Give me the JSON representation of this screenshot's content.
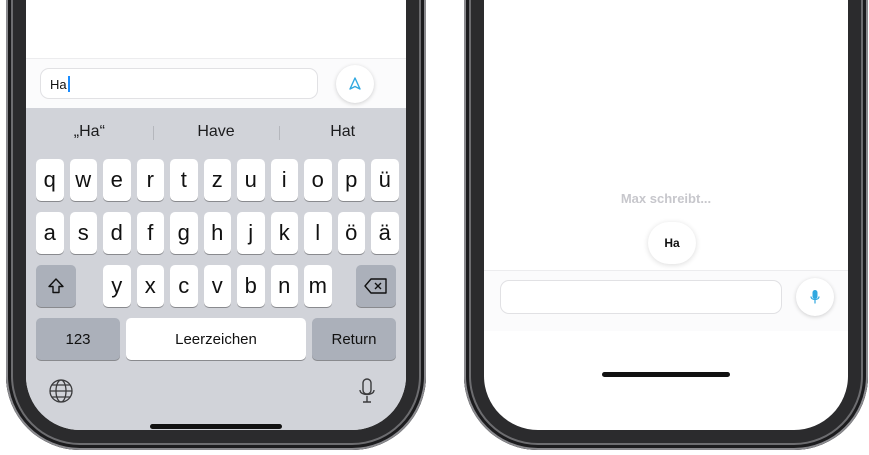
{
  "colors": {
    "accent": "#30a8e0",
    "keyboard_bg": "#d1d3d9",
    "fn_key": "#abb0ba",
    "muted_text": "#c7c7cc"
  },
  "left_phone": {
    "input": {
      "value": "Ha"
    },
    "send_icon": "send-arrow-icon",
    "suggestions": [
      "„Ha“",
      "Have",
      "Hat"
    ],
    "keys": {
      "row1": [
        "q",
        "w",
        "e",
        "r",
        "t",
        "z",
        "u",
        "i",
        "o",
        "p",
        "ü"
      ],
      "row2": [
        "a",
        "s",
        "d",
        "f",
        "g",
        "h",
        "j",
        "k",
        "l",
        "ö",
        "ä"
      ],
      "row3": [
        "y",
        "x",
        "c",
        "v",
        "b",
        "n",
        "m"
      ],
      "shift_icon": "shift-arrow-icon",
      "backspace_icon": "backspace-icon",
      "numbers_label": "123",
      "space_label": "Leerzeichen",
      "return_label": "Return",
      "globe_icon": "globe-icon",
      "dictation_icon": "microphone-icon"
    }
  },
  "right_phone": {
    "typing_indicator": "Max schreibt...",
    "bubble_text": "Ha",
    "mic_icon": "microphone-icon"
  }
}
